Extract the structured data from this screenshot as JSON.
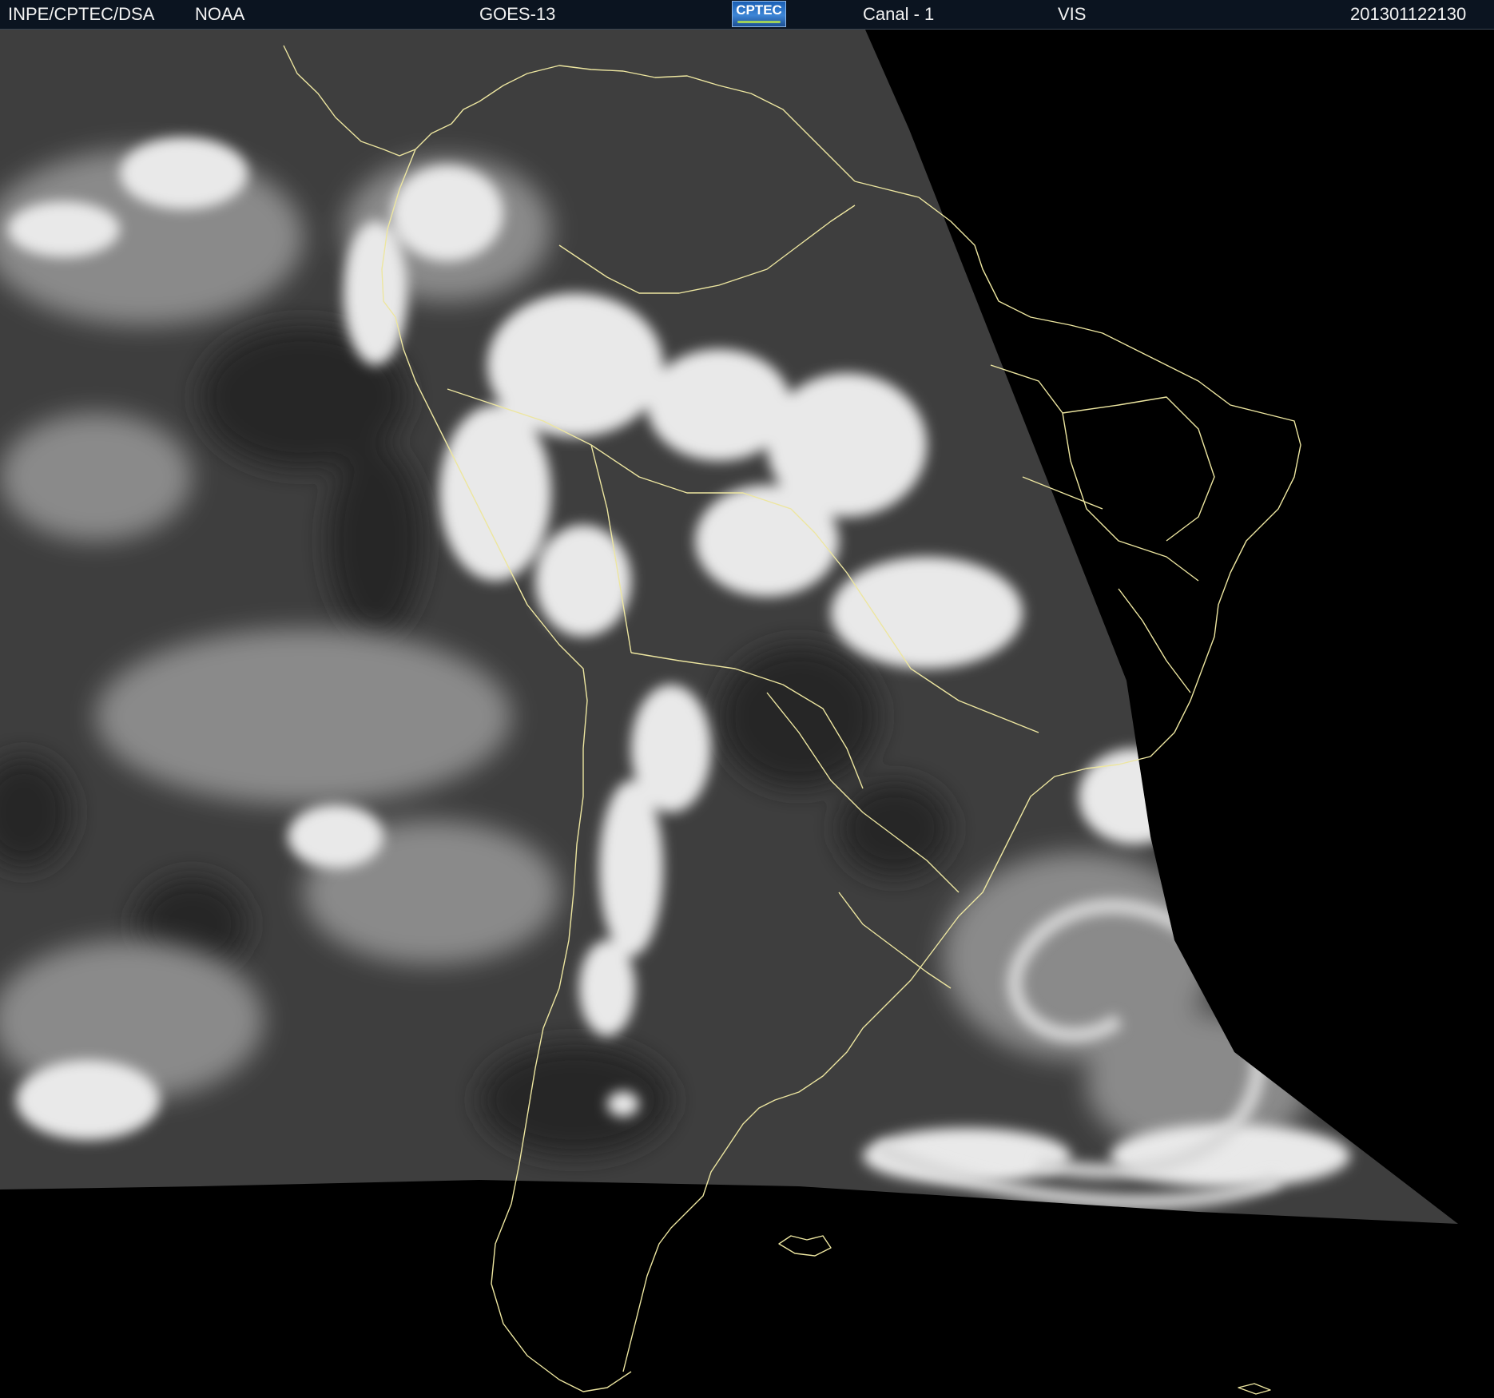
{
  "header": {
    "org": "INPE/CPTEC/DSA",
    "agency": "NOAA",
    "satellite": "GOES-13",
    "logo_text": "CPTEC",
    "channel": "Canal - 1",
    "band": "VIS",
    "timestamp": "201301122130"
  },
  "colors": {
    "header_bg": "#0b1420",
    "header_text": "#f2f2f2",
    "border_lines": "#ede6a0",
    "space": "#000000",
    "cloud": "#f4f4f4",
    "surface": "#4a4a4a"
  }
}
